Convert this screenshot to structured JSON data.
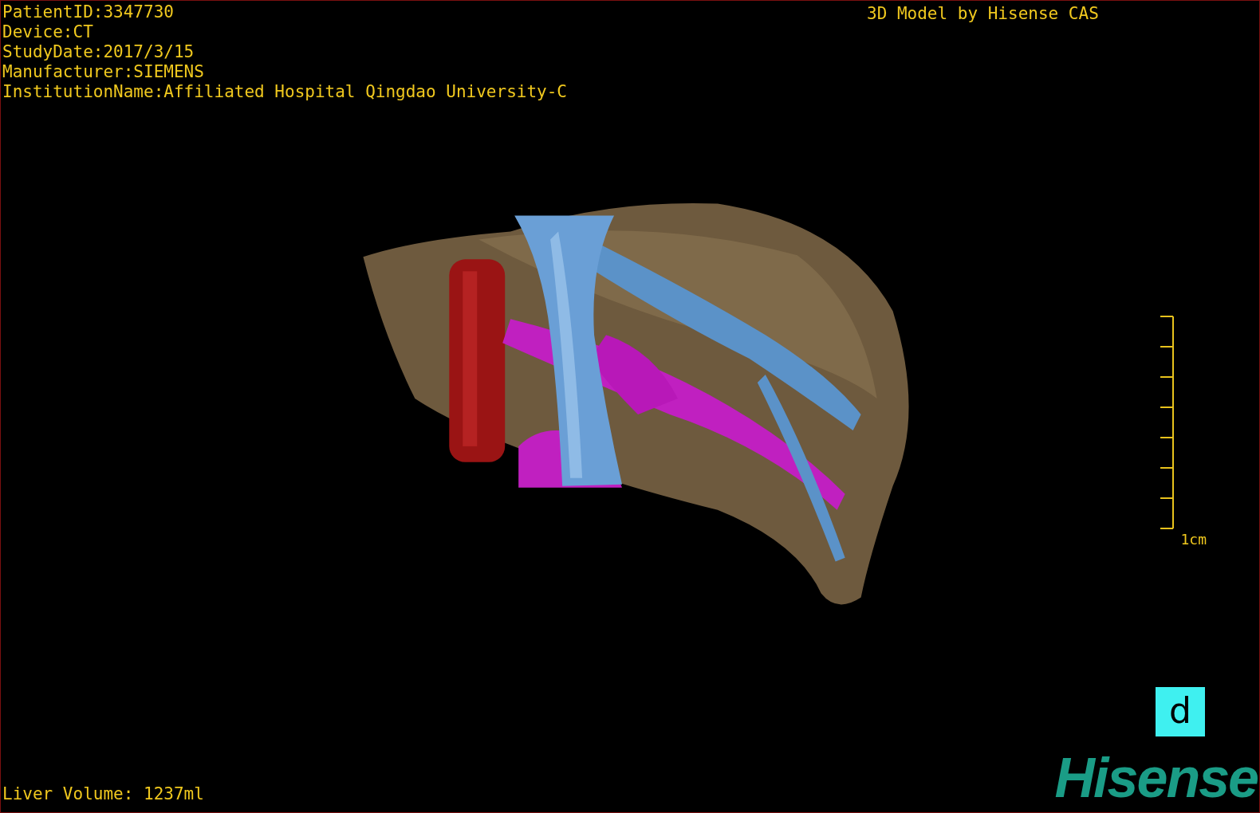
{
  "info_lines": [
    "PatientID:3347730",
    "Device:CT",
    "StudyDate:2017/3/15",
    "Manufacturer:SIEMENS",
    "InstitutionName:Affiliated Hospital Qingdao University-C"
  ],
  "title": "3D Model by Hisense CAS",
  "scale_bar": {
    "label": "1cm"
  },
  "orientation_marker": {
    "label": "d"
  },
  "volume": "Liver Volume: 1237ml",
  "logo": "Hisense"
}
